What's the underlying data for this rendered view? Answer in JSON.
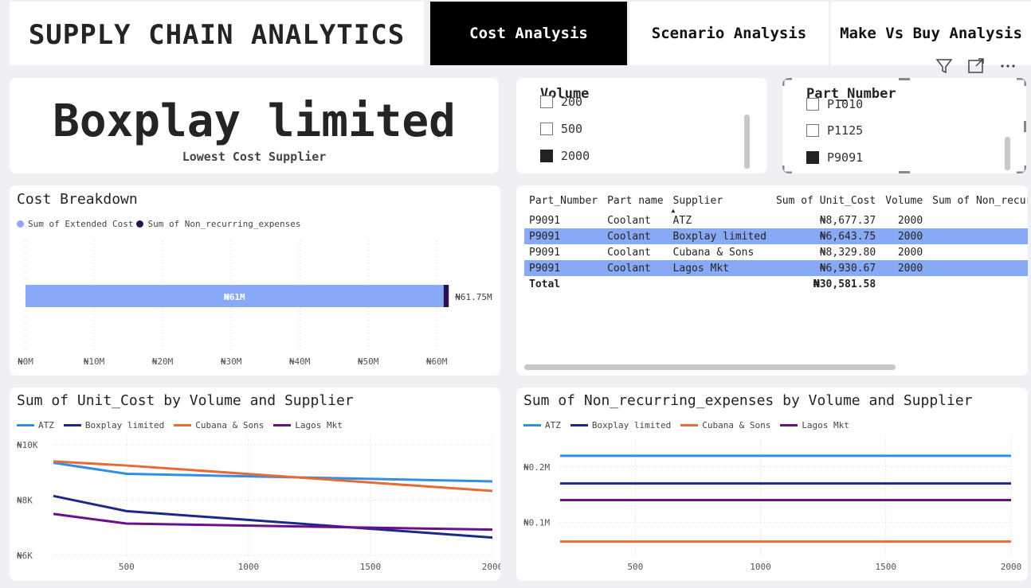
{
  "header": {
    "app_title": "SUPPLY CHAIN ANALYTICS",
    "nav": [
      {
        "label": "Cost Analysis",
        "active": true
      },
      {
        "label": "Scenario Analysis",
        "active": false
      },
      {
        "label": "Make Vs Buy Analysis",
        "active": false
      }
    ],
    "icons": [
      "filter-icon",
      "focus-mode-icon",
      "more-options-icon"
    ]
  },
  "kpi": {
    "value": "Boxplay limited",
    "label": "Lowest Cost Supplier"
  },
  "volume_slicer": {
    "title": "Volume",
    "items": [
      {
        "label": "200",
        "checked": false
      },
      {
        "label": "500",
        "checked": false
      },
      {
        "label": "2000",
        "checked": true
      }
    ]
  },
  "part_slicer": {
    "title": "Part_Number",
    "items": [
      {
        "label": "P1010",
        "checked": false
      },
      {
        "label": "P1125",
        "checked": false
      },
      {
        "label": "P9091",
        "checked": true
      }
    ]
  },
  "cost_breakdown": {
    "title": "Cost Breakdown",
    "legend": [
      {
        "label": "Sum of Extended Cost",
        "color": "#8aa8f8"
      },
      {
        "label": "Sum of Non_recurring_expenses",
        "color": "#2b1055"
      }
    ],
    "bar_label": "₦61M",
    "total_label": "₦61.75M",
    "x_ticks": [
      "₦0M",
      "₦10M",
      "₦20M",
      "₦30M",
      "₦40M",
      "₦50M",
      "₦60M"
    ]
  },
  "table": {
    "headers": [
      "Part_Number",
      "Part name",
      "Supplier",
      "Sum of Unit_Cost",
      "Volume",
      "Sum of Non_recurr"
    ],
    "rows": [
      {
        "part": "P9091",
        "name": "Coolant",
        "supplier": "ATZ",
        "unit_cost": "₦8,677.37",
        "volume": "2000",
        "highlight": false
      },
      {
        "part": "P9091",
        "name": "Coolant",
        "supplier": "Boxplay limited",
        "unit_cost": "₦6,643.75",
        "volume": "2000",
        "highlight": true
      },
      {
        "part": "P9091",
        "name": "Coolant",
        "supplier": "Cubana & Sons",
        "unit_cost": "₦8,329.80",
        "volume": "2000",
        "highlight": false
      },
      {
        "part": "P9091",
        "name": "Coolant",
        "supplier": "Lagos Mkt",
        "unit_cost": "₦6,930.67",
        "volume": "2000",
        "highlight": true
      }
    ],
    "total": {
      "label": "Total",
      "unit_cost": "₦30,581.58"
    }
  },
  "chart_data": [
    {
      "type": "bar",
      "orientation": "horizontal",
      "title": "Cost Breakdown",
      "stacked": true,
      "categories": [
        ""
      ],
      "series": [
        {
          "name": "Sum of Extended Cost",
          "values": [
            61.0
          ]
        },
        {
          "name": "Sum of Non_recurring_expenses",
          "values": [
            0.75
          ]
        }
      ],
      "xlim": [
        0,
        68
      ],
      "unit": "₦M",
      "grid": true,
      "legend": "top-left"
    },
    {
      "type": "line",
      "title": "Sum of Unit_Cost by Volume and Supplier",
      "x": [
        200,
        500,
        2000
      ],
      "x_ticks": [
        "500",
        "1000",
        "1500",
        "2000"
      ],
      "y_ticks": [
        "₦6K",
        "₦8K",
        "₦10K"
      ],
      "ylim": [
        6000,
        10000
      ],
      "xlim": [
        200,
        2000
      ],
      "legend": "top-left",
      "grid": true,
      "series": [
        {
          "name": "ATZ",
          "color": "#2f8fe8",
          "values": [
            9350,
            8950,
            8677
          ]
        },
        {
          "name": "Boxplay limited",
          "color": "#1b2a8a",
          "values": [
            8150,
            7600,
            6644
          ]
        },
        {
          "name": "Cubana & Sons",
          "color": "#e66b37",
          "values": [
            9400,
            9250,
            8330
          ]
        },
        {
          "name": "Lagos Mkt",
          "color": "#6b0f8a",
          "values": [
            7500,
            7150,
            6931
          ]
        }
      ]
    },
    {
      "type": "line",
      "title": "Sum of Non_recurring_expenses by Volume and Supplier",
      "x": [
        200,
        500,
        2000
      ],
      "x_ticks": [
        "500",
        "1000",
        "1500",
        "2000"
      ],
      "y_ticks": [
        "₦0.1M",
        "₦0.2M"
      ],
      "ylim": [
        0.04,
        0.24
      ],
      "xlim": [
        200,
        2000
      ],
      "legend": "top-left",
      "grid": true,
      "series": [
        {
          "name": "ATZ",
          "color": "#2f8fe8",
          "values": [
            0.22,
            0.22,
            0.22
          ]
        },
        {
          "name": "Boxplay limited",
          "color": "#1b2a8a",
          "values": [
            0.17,
            0.17,
            0.17
          ]
        },
        {
          "name": "Cubana & Sons",
          "color": "#e66b37",
          "values": [
            0.065,
            0.065,
            0.065
          ]
        },
        {
          "name": "Lagos Mkt",
          "color": "#6b0f8a",
          "values": [
            0.14,
            0.14,
            0.14
          ]
        }
      ]
    }
  ]
}
